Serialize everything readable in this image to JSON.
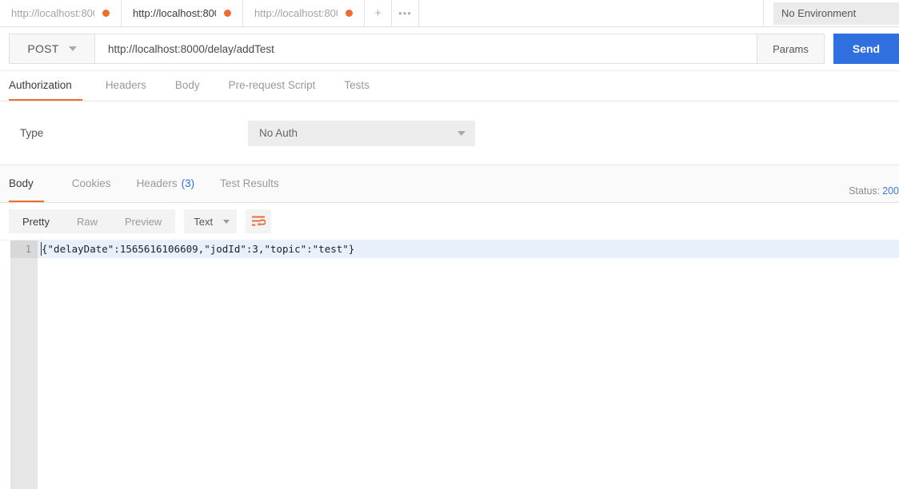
{
  "tabstrip": {
    "tabs": [
      {
        "label": "http://localhost:800",
        "active": false,
        "dot": true
      },
      {
        "label": "http://localhost:800",
        "active": true,
        "dot": true
      },
      {
        "label": "http://localhost:800",
        "active": false,
        "dot": true
      }
    ],
    "new_tab_label": "+",
    "more_label": "•••",
    "environment": "No Environment"
  },
  "request": {
    "method": "POST",
    "url": "http://localhost:8000/delay/addTest",
    "params_label": "Params",
    "send_label": "Send",
    "tabs": [
      {
        "label": "Authorization",
        "active": true
      },
      {
        "label": "Headers",
        "active": false
      },
      {
        "label": "Body",
        "active": false
      },
      {
        "label": "Pre-request Script",
        "active": false
      },
      {
        "label": "Tests",
        "active": false
      }
    ],
    "auth": {
      "type_label": "Type",
      "type_value": "No Auth"
    }
  },
  "response": {
    "tabs": [
      {
        "label": "Body",
        "active": true,
        "count": ""
      },
      {
        "label": "Cookies",
        "active": false,
        "count": ""
      },
      {
        "label": "Headers",
        "active": false,
        "count": "(3)"
      },
      {
        "label": "Test Results",
        "active": false,
        "count": ""
      }
    ],
    "status_label": "Status:",
    "status_code": "200",
    "view_modes": [
      {
        "label": "Pretty",
        "active": true
      },
      {
        "label": "Raw",
        "active": false
      },
      {
        "label": "Preview",
        "active": false
      }
    ],
    "format": "Text",
    "wrap_icon": "word-wrap-icon",
    "body_lines": [
      {
        "number": "1",
        "text": "{\"delayDate\":1565616106609,\"jodId\":3,\"topic\":\"test\"}"
      }
    ]
  },
  "colors": {
    "accent": "#ef6c2e",
    "send": "#2f6fe0",
    "link": "#3b7dd8"
  }
}
